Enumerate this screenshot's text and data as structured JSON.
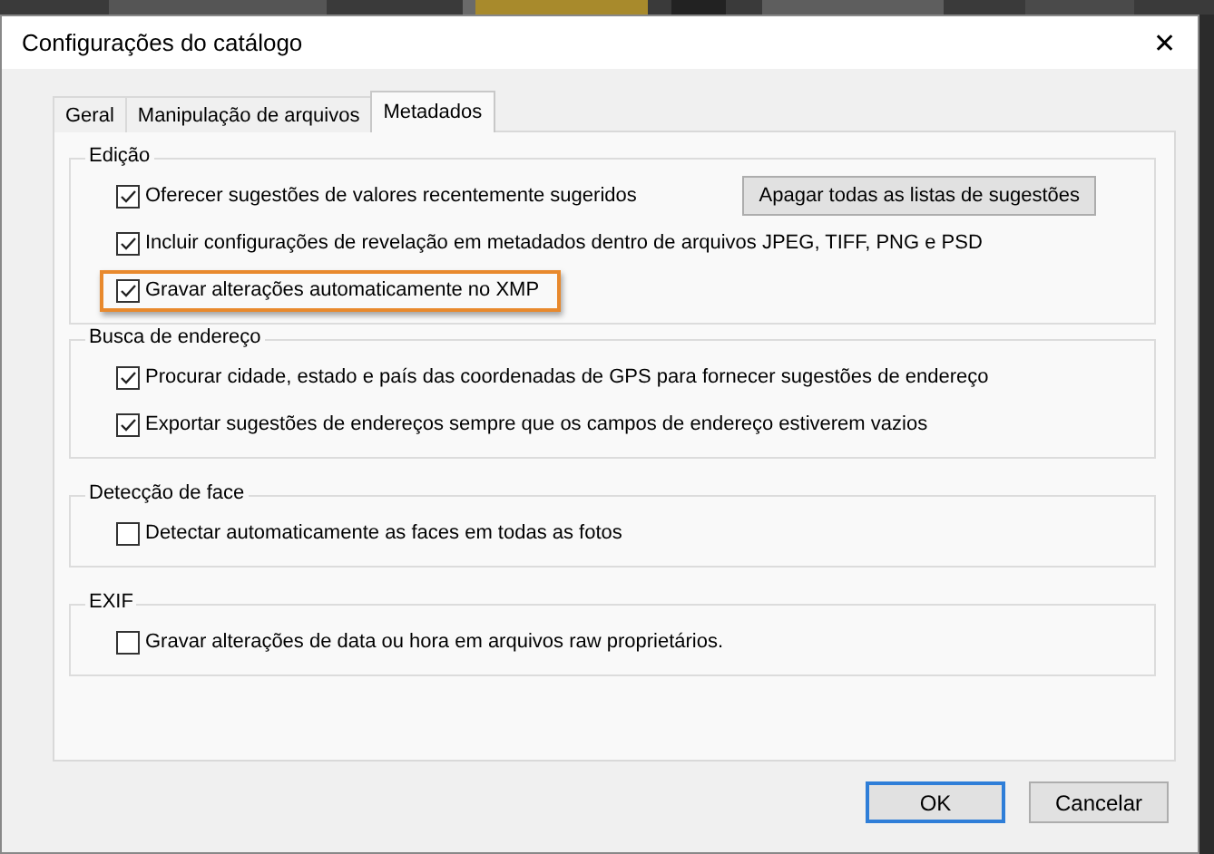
{
  "window": {
    "title": "Configurações do catálogo",
    "close": "✕"
  },
  "tabs": [
    {
      "label": "Geral",
      "selected": false
    },
    {
      "label": "Manipulação de arquivos",
      "selected": false
    },
    {
      "label": "Metadados",
      "selected": true
    }
  ],
  "groups": [
    {
      "title": "Edição",
      "items": [
        {
          "label": "Oferecer sugestões de valores recentemente sugeridos",
          "checked": true,
          "highlighted": false,
          "button": "Apagar todas as listas de sugestões"
        },
        {
          "label": "Incluir configurações de revelação em metadados dentro de arquivos JPEG, TIFF, PNG e PSD",
          "checked": true,
          "highlighted": false
        },
        {
          "label": "Gravar alterações automaticamente no XMP",
          "checked": true,
          "highlighted": true
        }
      ]
    },
    {
      "title": "Busca de endereço",
      "items": [
        {
          "label": "Procurar cidade, estado e país das coordenadas de GPS para fornecer sugestões de endereço",
          "checked": true,
          "highlighted": false
        },
        {
          "label": "Exportar sugestões de endereços sempre que os campos de endereço estiverem vazios",
          "checked": true,
          "highlighted": false
        }
      ]
    },
    {
      "title": "Detecção de face",
      "items": [
        {
          "label": "Detectar automaticamente as faces em todas as fotos",
          "checked": false,
          "highlighted": false
        }
      ]
    },
    {
      "title": "EXIF",
      "items": [
        {
          "label": "Gravar alterações de data ou hora em arquivos raw proprietários.",
          "checked": false,
          "highlighted": false
        }
      ]
    }
  ],
  "buttons": [
    {
      "label": "OK",
      "default": true
    },
    {
      "label": "Cancelar",
      "default": false
    }
  ]
}
